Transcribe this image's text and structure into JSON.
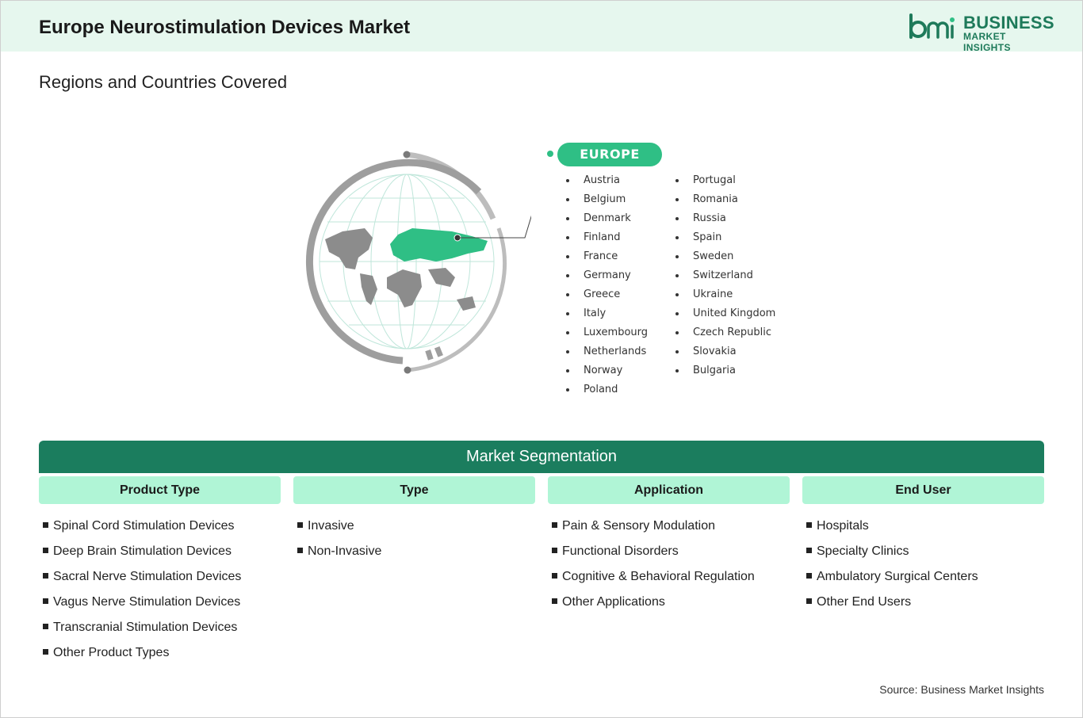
{
  "header": {
    "title": "Europe Neurostimulation Devices Market",
    "logo_line1": "BUSINESS",
    "logo_line2": "MARKET INSIGHTS",
    "brand_color": "#1e7a5a"
  },
  "subtitle": "Regions and Countries Covered",
  "region": {
    "label": "EUROPE",
    "accent_color": "#2fbf85",
    "countries_col1": [
      "Austria",
      "Belgium",
      "Denmark",
      "Finland",
      "France",
      "Germany",
      "Greece",
      "Italy",
      "Luxembourg",
      "Netherlands",
      "Norway",
      "Poland"
    ],
    "countries_col2": [
      "Portugal",
      "Romania",
      "Russia",
      "Spain",
      "Sweden",
      "Switzerland",
      "Ukraine",
      "United Kingdom",
      "Czech Republic",
      "Slovakia",
      "Bulgaria"
    ]
  },
  "segmentation": {
    "title": "Market Segmentation",
    "bar_color": "#1b7d5e",
    "header_color": "#b0f5d6",
    "columns": [
      {
        "heading": "Product Type",
        "items": [
          "Spinal Cord Stimulation Devices",
          "Deep Brain Stimulation Devices",
          "Sacral Nerve Stimulation Devices",
          "Vagus Nerve Stimulation Devices",
          "Transcranial Stimulation Devices",
          "Other Product Types"
        ]
      },
      {
        "heading": "Type",
        "items": [
          "Invasive",
          "Non-Invasive"
        ]
      },
      {
        "heading": "Application",
        "items": [
          "Pain & Sensory Modulation",
          "Functional Disorders",
          "Cognitive & Behavioral Regulation",
          "Other Applications"
        ]
      },
      {
        "heading": "End User",
        "items": [
          "Hospitals",
          "Specialty Clinics",
          "Ambulatory Surgical Centers",
          "Other End Users"
        ]
      }
    ]
  },
  "source": "Source: Business Market Insights"
}
